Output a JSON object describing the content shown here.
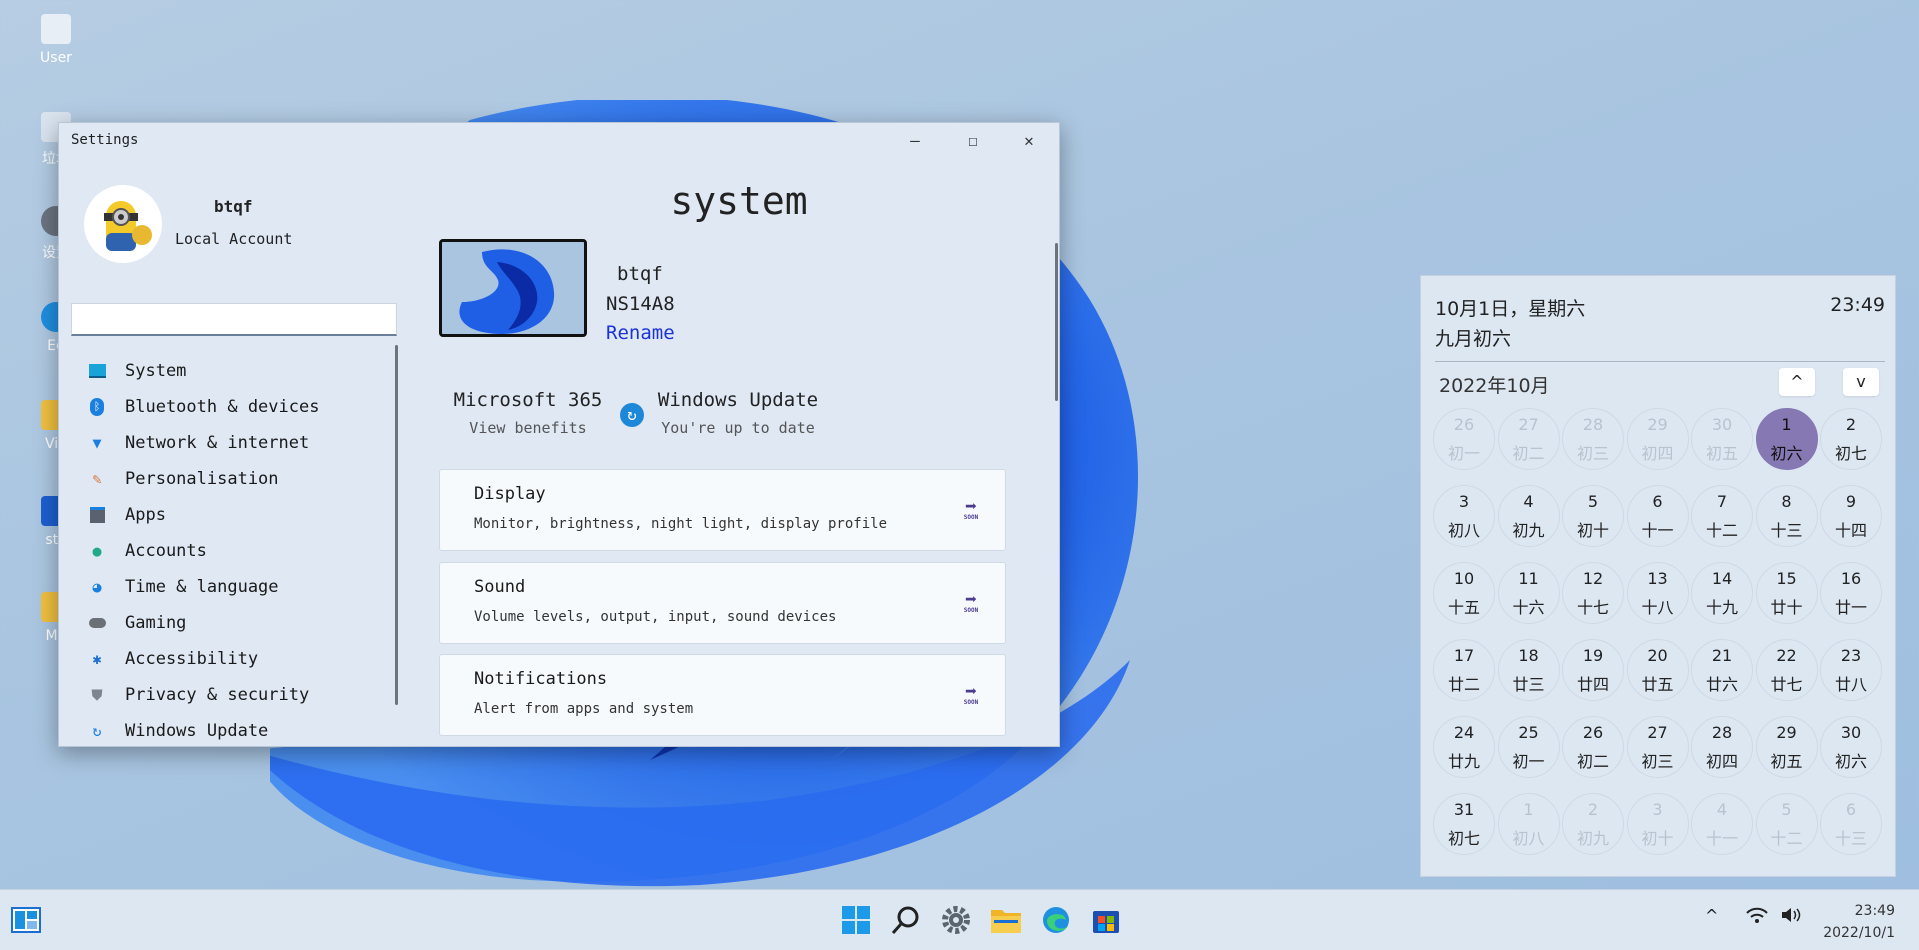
{
  "desktop": {
    "icons": [
      {
        "label": "User"
      },
      {
        "label": "垃圾"
      },
      {
        "label": "设置"
      },
      {
        "label": "Ed"
      },
      {
        "label": "Vid"
      },
      {
        "label": "sto"
      },
      {
        "label": "Mu"
      }
    ]
  },
  "settings": {
    "title": "Settings",
    "controls": {
      "minimize": "—",
      "maximize": "☐",
      "close": "✕"
    },
    "account": {
      "name": "btqf",
      "type": "Local Account"
    },
    "search": {
      "placeholder": ""
    },
    "nav": [
      {
        "label": "System",
        "icon": "monitor-icon",
        "color": "#1aa3d8"
      },
      {
        "label": "Bluetooth & devices",
        "icon": "bluetooth-icon",
        "color": "#1b7fe0"
      },
      {
        "label": "Network & internet",
        "icon": "wifi-icon",
        "color": "#1b7fe0"
      },
      {
        "label": "Personalisation",
        "icon": "brush-icon",
        "color": "#d6773a"
      },
      {
        "label": "Apps",
        "icon": "apps-icon",
        "color": "#5a6270"
      },
      {
        "label": "Accounts",
        "icon": "person-icon",
        "color": "#22a88a"
      },
      {
        "label": "Time & language",
        "icon": "globe-icon",
        "color": "#1b7fe0"
      },
      {
        "label": "Gaming",
        "icon": "gamepad-icon",
        "color": "#6b6f76"
      },
      {
        "label": "Accessibility",
        "icon": "accessibility-icon",
        "color": "#1b6fd0"
      },
      {
        "label": "Privacy & security",
        "icon": "shield-icon",
        "color": "#7d8590"
      },
      {
        "label": "Windows Update",
        "icon": "update-icon",
        "color": "#1b7fe0"
      }
    ],
    "main": {
      "heading": "system",
      "device": {
        "user": "btqf",
        "name": "NS14A8",
        "rename": "Rename"
      },
      "promos": [
        {
          "title": "Microsoft 365",
          "subtitle": "View benefits"
        },
        {
          "title": "Windows Update",
          "subtitle": "You're up to date"
        }
      ],
      "cards": [
        {
          "title": "Display",
          "desc": "Monitor, brightness, night light, display profile",
          "badge": "SOON"
        },
        {
          "title": "Sound",
          "desc": "Volume levels, output, input, sound devices",
          "badge": "SOON"
        },
        {
          "title": "Notifications",
          "desc": "Alert from apps and system",
          "badge": "SOON"
        }
      ]
    }
  },
  "calendar": {
    "date_line": "10月1日，星期六",
    "lunar_line": "九月初六",
    "time": "23:49",
    "month_label": "2022年10月",
    "prev": "^",
    "next": "v",
    "days": [
      {
        "d": "26",
        "l": "初一",
        "dim": true
      },
      {
        "d": "27",
        "l": "初二",
        "dim": true
      },
      {
        "d": "28",
        "l": "初三",
        "dim": true
      },
      {
        "d": "29",
        "l": "初四",
        "dim": true
      },
      {
        "d": "30",
        "l": "初五",
        "dim": true
      },
      {
        "d": "1",
        "l": "初六",
        "sel": true
      },
      {
        "d": "2",
        "l": "初七"
      },
      {
        "d": "3",
        "l": "初八"
      },
      {
        "d": "4",
        "l": "初九"
      },
      {
        "d": "5",
        "l": "初十"
      },
      {
        "d": "6",
        "l": "十一"
      },
      {
        "d": "7",
        "l": "十二"
      },
      {
        "d": "8",
        "l": "十三"
      },
      {
        "d": "9",
        "l": "十四"
      },
      {
        "d": "10",
        "l": "十五"
      },
      {
        "d": "11",
        "l": "十六"
      },
      {
        "d": "12",
        "l": "十七"
      },
      {
        "d": "13",
        "l": "十八"
      },
      {
        "d": "14",
        "l": "十九"
      },
      {
        "d": "15",
        "l": "廿十"
      },
      {
        "d": "16",
        "l": "廿一"
      },
      {
        "d": "17",
        "l": "廿二"
      },
      {
        "d": "18",
        "l": "廿三"
      },
      {
        "d": "19",
        "l": "廿四"
      },
      {
        "d": "20",
        "l": "廿五"
      },
      {
        "d": "21",
        "l": "廿六"
      },
      {
        "d": "22",
        "l": "廿七"
      },
      {
        "d": "23",
        "l": "廿八"
      },
      {
        "d": "24",
        "l": "廿九"
      },
      {
        "d": "25",
        "l": "初一"
      },
      {
        "d": "26",
        "l": "初二"
      },
      {
        "d": "27",
        "l": "初三"
      },
      {
        "d": "28",
        "l": "初四"
      },
      {
        "d": "29",
        "l": "初五"
      },
      {
        "d": "30",
        "l": "初六"
      },
      {
        "d": "31",
        "l": "初七"
      },
      {
        "d": "1",
        "l": "初八",
        "dim": true
      },
      {
        "d": "2",
        "l": "初九",
        "dim": true
      },
      {
        "d": "3",
        "l": "初十",
        "dim": true
      },
      {
        "d": "4",
        "l": "十一",
        "dim": true
      },
      {
        "d": "5",
        "l": "十二",
        "dim": true
      },
      {
        "d": "6",
        "l": "十三",
        "dim": true
      }
    ]
  },
  "taskbar": {
    "tray_chevron": "^",
    "clock_time": "23:49",
    "clock_date": "2022/10/1"
  }
}
